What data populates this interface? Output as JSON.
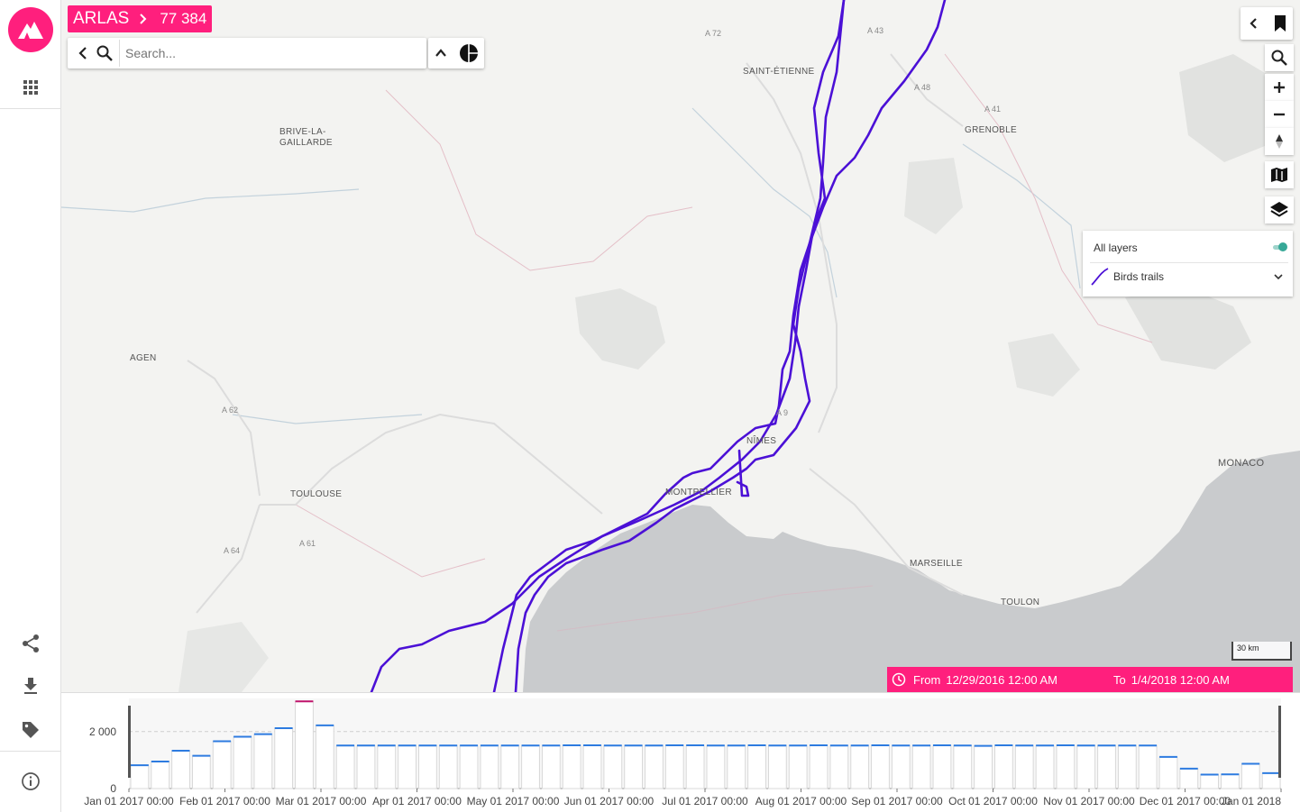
{
  "app": {
    "name": "ARLAS",
    "count": "77 384",
    "search_placeholder": "Search..."
  },
  "sidebar": {
    "items": [
      {
        "icon": "apps-icon"
      },
      {
        "icon": "share-icon"
      },
      {
        "icon": "download-icon"
      },
      {
        "icon": "tag-icon"
      },
      {
        "icon": "info-icon"
      }
    ]
  },
  "map": {
    "cities": [
      "SAINT-ÉTIENNE",
      "GRENOBLE",
      "BRIVE-LA-",
      "GAILLARDE",
      "AGEN",
      "TOULOUSE",
      "NÎMES",
      "MONTPELLIER",
      "MARSEILLE",
      "TOULON",
      "MONACO"
    ],
    "roads": [
      "A 72",
      "A 43",
      "A 48",
      "A 41",
      "A 62",
      "A 64",
      "A 61",
      "A 9"
    ],
    "scale_label": "30 km",
    "trail_color": "#4b10d6"
  },
  "layers": {
    "all_label": "All layers",
    "layer_name": "Birds trails",
    "all_enabled": true
  },
  "time_range": {
    "from_label": "From",
    "from_value": "12/29/2016 12:00 AM",
    "to_label": "To",
    "to_value": "1/4/2018 12:00 AM"
  },
  "chart_data": {
    "type": "bar",
    "ylabel": "",
    "y_ticks": [
      "0",
      "2 000"
    ],
    "ylim": [
      0,
      3100
    ],
    "x_ticks": [
      "Jan 01 2017 00:00",
      "Feb 01 2017 00:00",
      "Mar 01 2017 00:00",
      "Apr 01 2017 00:00",
      "May 01 2017 00:00",
      "Jun 01 2017 00:00",
      "Jul 01 2017 00:00",
      "Aug 01 2017 00:00",
      "Sep 01 2017 00:00",
      "Oct 01 2017 00:00",
      "Nov 01 2017 00:00",
      "Dec 01 2017 00:00",
      "Jan 01 2018"
    ],
    "values": [
      820,
      950,
      1330,
      1150,
      1660,
      1820,
      1910,
      2120,
      3060,
      2220,
      1510,
      1510,
      1510,
      1510,
      1510,
      1510,
      1510,
      1510,
      1510,
      1510,
      1510,
      1520,
      1520,
      1510,
      1510,
      1510,
      1520,
      1520,
      1510,
      1510,
      1520,
      1510,
      1510,
      1520,
      1510,
      1510,
      1520,
      1510,
      1510,
      1520,
      1510,
      1500,
      1520,
      1510,
      1510,
      1520,
      1510,
      1510,
      1510,
      1510,
      1110,
      700,
      490,
      500,
      870,
      540
    ],
    "bar_color": "#2d7be0",
    "highlight_color": "#c0146b",
    "grid": true
  }
}
